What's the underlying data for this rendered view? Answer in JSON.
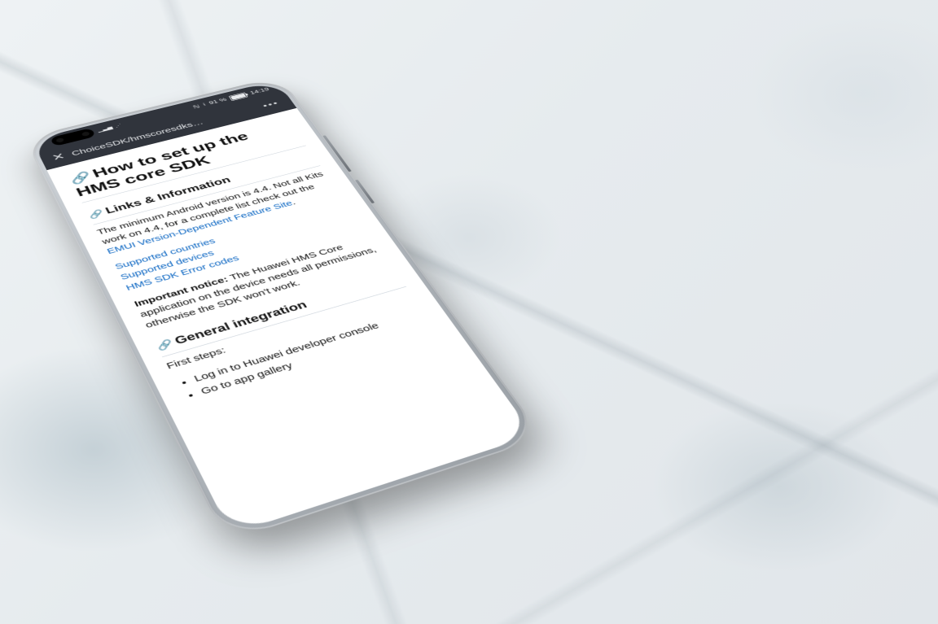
{
  "status": {
    "battery_pct": "91 %",
    "time": "14:19",
    "nfc_glyph": "ℕ",
    "bt_glyph": "⟊",
    "signal_glyph": "▁▃▅",
    "wifi_glyph": "⋰"
  },
  "appbar": {
    "title": "ChoiceSDK/hmscoresdks…",
    "overflow_glyph": "•••",
    "close_glyph": "✕"
  },
  "doc": {
    "anchor_glyph": "🔗",
    "title": "How to set up the HMS core SDK",
    "s1_heading": "Links & Information",
    "s1_para_pre": "The minimum Android version is 4.4. Not all Kits work on 4.4, for a complete list check out the ",
    "s1_para_link": "EMUI Version-Dependent Feature Site",
    "s1_para_post": ".",
    "links": {
      "a": "Supported countries",
      "b": "Supported devices",
      "c": "HMS SDK Error codes"
    },
    "notice_label": "Important notice:",
    "notice_body": " The Huawei HMS Core application on the device needs all permissions, otherwise the SDK won't work.",
    "s2_heading": "General integration",
    "s2_intro": "First steps:",
    "s2_items": {
      "a": "Log in to Huawei developer console",
      "b": "Go to app gallery"
    }
  }
}
